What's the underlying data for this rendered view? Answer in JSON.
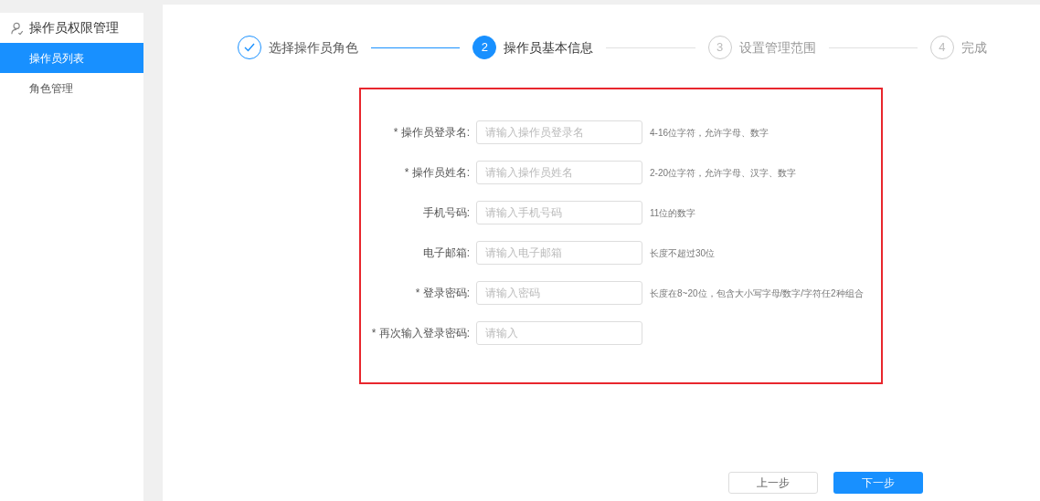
{
  "sidebar": {
    "group": {
      "label": "操作员权限管理"
    },
    "items": [
      {
        "label": "操作员列表",
        "selected": true
      },
      {
        "label": "角色管理",
        "selected": false
      }
    ]
  },
  "steps": [
    {
      "label": "选择操作员角色",
      "completed": true,
      "selected": false
    },
    {
      "number": "2",
      "label": "操作员基本信息",
      "completed": false,
      "selected": true
    },
    {
      "number": "3",
      "label": "设置管理范围",
      "completed": false,
      "selected": false
    },
    {
      "number": "4",
      "label": "完成",
      "completed": false,
      "selected": false
    }
  ],
  "form": {
    "fields": [
      {
        "label": "* 操作员登录名:",
        "placeholder": "请输入操作员登录名",
        "hint": "4-16位字符，允许字母、数字"
      },
      {
        "label": "* 操作员姓名:",
        "placeholder": "请输入操作员姓名",
        "hint": "2-20位字符，允许字母、汉字、数字"
      },
      {
        "label": "手机号码:",
        "placeholder": "请输入手机号码",
        "hint": "11位的数字"
      },
      {
        "label": "电子邮箱:",
        "placeholder": "请输入电子邮箱",
        "hint": "长度不超过30位"
      },
      {
        "label": "* 登录密码:",
        "placeholder": "请输入密码",
        "hint": "长度在8~20位，包含大小写字母/数字/字符任2种组合"
      },
      {
        "label": "* 再次输入登录密码:",
        "placeholder": "请输入"
      }
    ]
  },
  "buttons": [
    {
      "label": "上一步",
      "kind": "secondary"
    },
    {
      "label": "下一步",
      "kind": "primary"
    }
  ]
}
